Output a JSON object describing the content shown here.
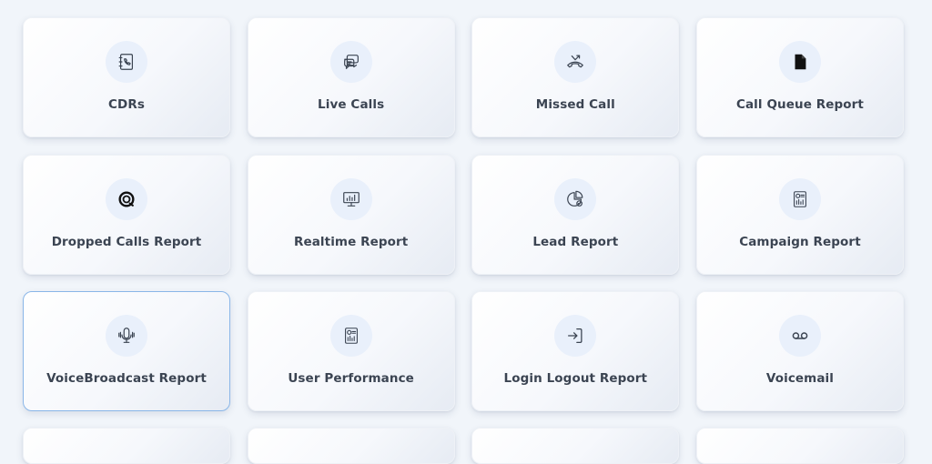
{
  "cards": [
    {
      "label": "CDRs",
      "icon": "phone-book-icon"
    },
    {
      "label": "Live Calls",
      "icon": "chat-bubbles-icon"
    },
    {
      "label": "Missed Call",
      "icon": "missed-call-icon"
    },
    {
      "label": "Call Queue Report",
      "icon": "document-icon"
    },
    {
      "label": "Dropped Calls Report",
      "icon": "dropped-call-icon"
    },
    {
      "label": "Realtime Report",
      "icon": "monitor-chart-icon"
    },
    {
      "label": "Lead Report",
      "icon": "pie-chart-icon"
    },
    {
      "label": "Campaign Report",
      "icon": "report-chart-icon"
    },
    {
      "label": "VoiceBroadcast Report",
      "icon": "microphone-icon"
    },
    {
      "label": "User Performance",
      "icon": "report-chart-icon"
    },
    {
      "label": "Login Logout Report",
      "icon": "login-icon"
    },
    {
      "label": "Voicemail",
      "icon": "voicemail-icon"
    }
  ],
  "selected_index": 8,
  "colors": {
    "background": "#f1f5fa",
    "card_label": "#3b4452",
    "icon_circle": "#e9f0fb",
    "icon_stroke": "#3b4452",
    "selected_border": "#8ab6e8"
  }
}
